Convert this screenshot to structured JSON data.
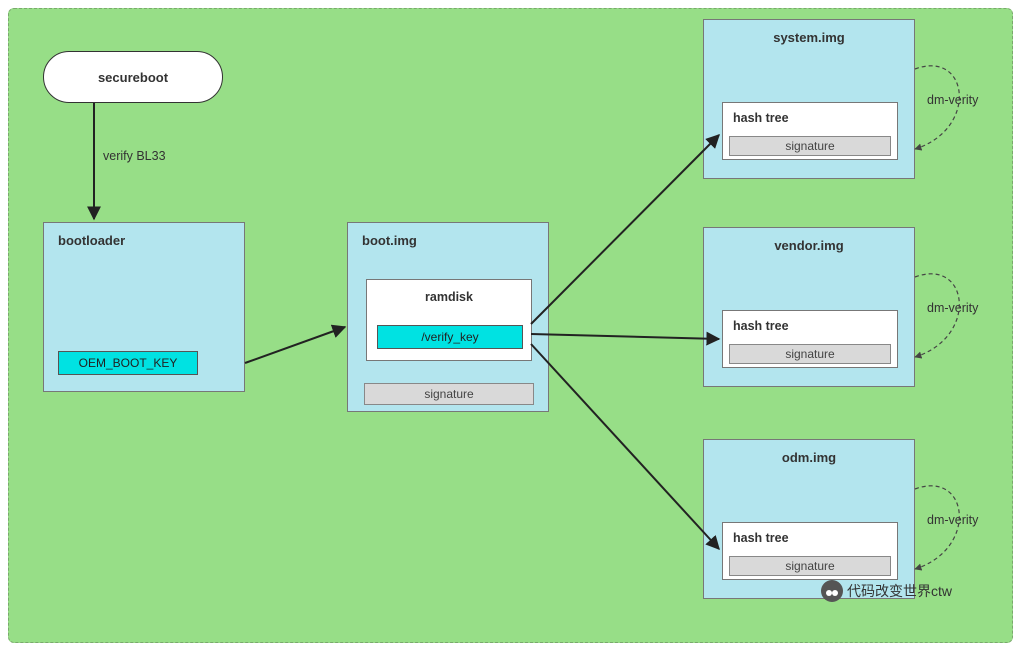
{
  "diagram": {
    "background_green": "#97de87",
    "box_fill": "#b3e5ee",
    "cyan_fill": "#00e2e2",
    "grey_fill": "#d9d9d9"
  },
  "secureboot": {
    "label": "secureboot"
  },
  "edge_verify_bl33": "verify BL33",
  "bootloader": {
    "title": "bootloader",
    "oem_key": "OEM_BOOT_KEY"
  },
  "bootimg": {
    "title": "boot.img",
    "ramdisk_title": "ramdisk",
    "verify_key": "/verify_key",
    "signature": "signature"
  },
  "systemimg": {
    "title": "system.img",
    "hashtree": "hash tree",
    "signature": "signature",
    "loop_label": "dm-verity"
  },
  "vendorimg": {
    "title": "vendor.img",
    "hashtree": "hash tree",
    "signature": "signature",
    "loop_label": "dm-verity"
  },
  "odmimg": {
    "title": "odm.img",
    "hashtree": "hash tree",
    "signature": "signature",
    "loop_label": "dm-verity"
  },
  "watermark": "代码改变世界ctw"
}
